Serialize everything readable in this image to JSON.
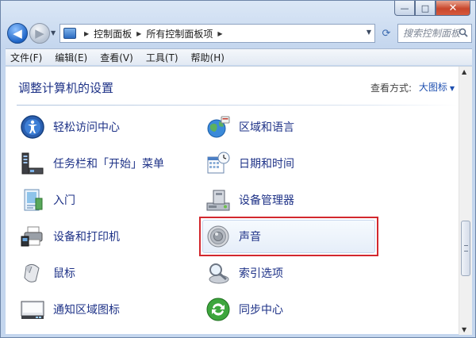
{
  "window": {
    "caption_buttons": {
      "minimize": "—",
      "maximize": "□",
      "close": "✕"
    }
  },
  "navbar": {
    "back_glyph": "◀",
    "forward_glyph": "▶",
    "dropdown_glyph": "▼",
    "breadcrumbs": [
      "控制面板",
      "所有控制面板项"
    ],
    "crumb_separator": "▶",
    "refresh_glyph": "⟳",
    "search_placeholder": "搜索控制面板"
  },
  "menubar": {
    "items": [
      "文件(F)",
      "编辑(E)",
      "查看(V)",
      "工具(T)",
      "帮助(H)"
    ]
  },
  "content": {
    "title": "调整计算机的设置",
    "view_by_label": "查看方式:",
    "view_mode": "大图标",
    "view_mode_dd": "▼",
    "items_left": [
      "轻松访问中心",
      "任务栏和「开始」菜单",
      "入门",
      "设备和打印机",
      "鼠标",
      "通知区域图标"
    ],
    "items_right": [
      "区域和语言",
      "日期和时间",
      "设备管理器",
      "声音",
      "索引选项",
      "同步中心"
    ],
    "highlighted_item": "声音"
  },
  "scrollbar": {
    "up_glyph": "▲",
    "down_glyph": "▼"
  },
  "colors": {
    "link_text": "#1e3287",
    "highlight_border": "#d2282e",
    "accent_blue": "#1f66c8"
  }
}
